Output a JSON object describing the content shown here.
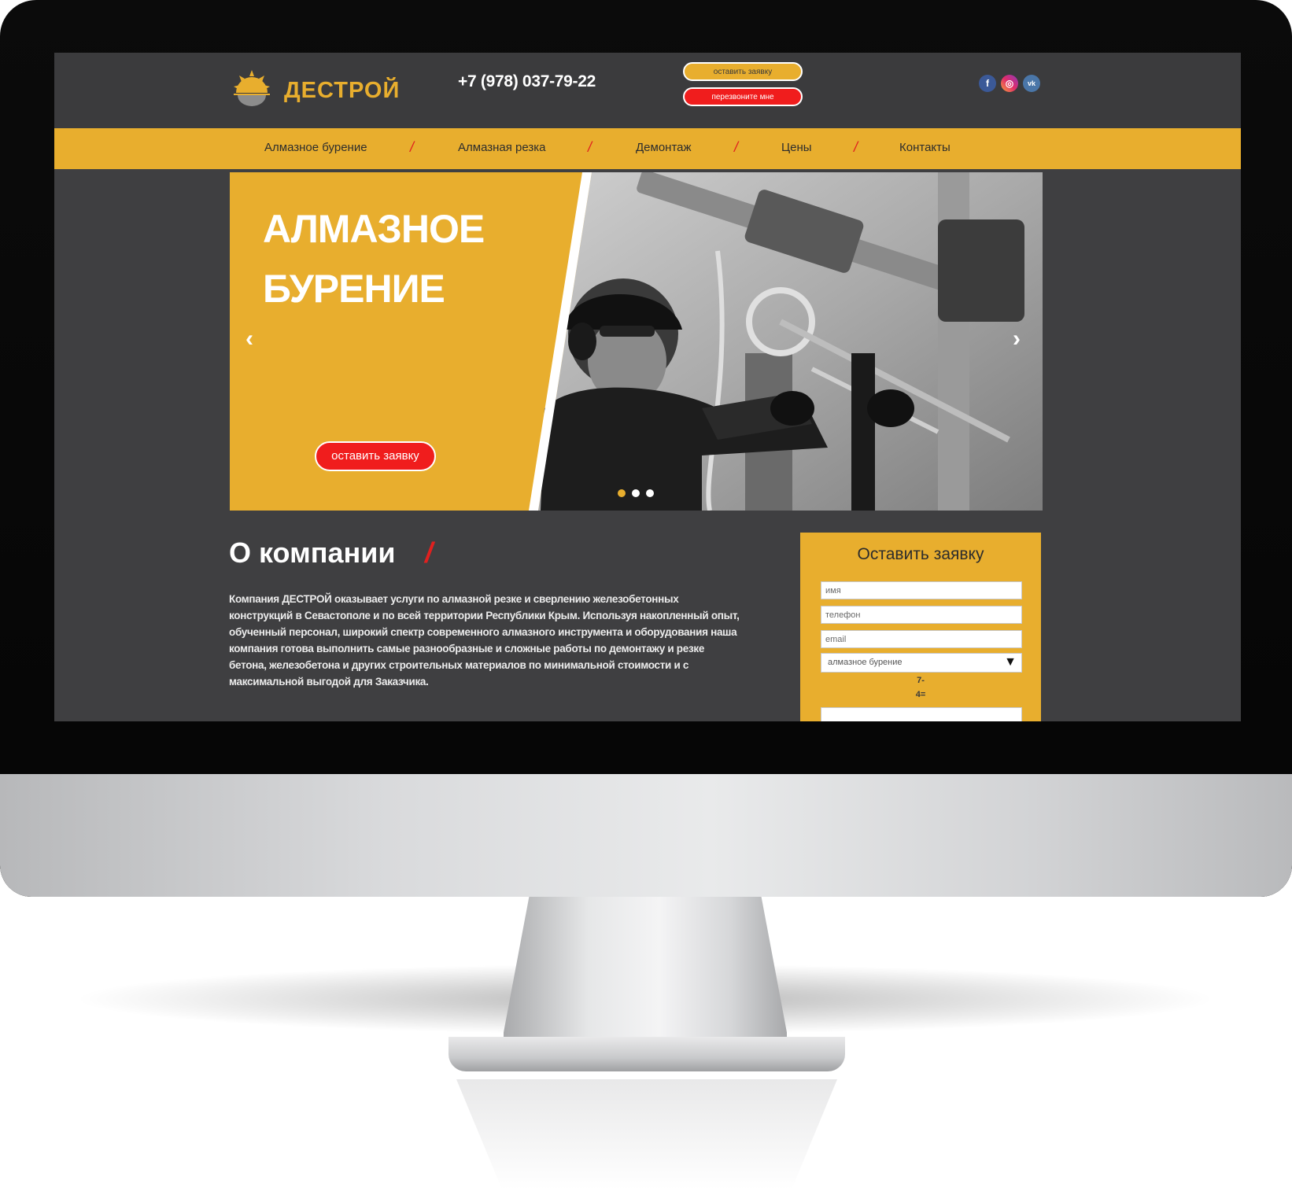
{
  "brand": {
    "name": "ДЕСТРОЙ",
    "accent_color": "#e8ae2e",
    "red_color": "#f01d1d",
    "dark_color": "#3f3f41"
  },
  "header": {
    "phone": "+7 (978) 037-79-22",
    "request_button": "оставить заявку",
    "callback_button": "перезвоните мне",
    "socials": [
      {
        "icon": "facebook-icon",
        "glyph": "f"
      },
      {
        "icon": "instagram-icon",
        "glyph": "◎"
      },
      {
        "icon": "vk-icon",
        "glyph": "vk"
      }
    ]
  },
  "nav": {
    "items": [
      "Алмазное бурение",
      "Алмазная резка",
      "Демонтаж",
      "Цены",
      "Контакты"
    ],
    "separator": "/"
  },
  "slider": {
    "title_line1": "АЛМАЗНОЕ",
    "title_line2": "БУРЕНИЕ",
    "cta": "оставить заявку",
    "prev_icon": "‹",
    "next_icon": "›",
    "slide_count": 3,
    "active_slide": 1
  },
  "about": {
    "title": "О компании",
    "slash": "/",
    "text": "Компания ДЕСТРОЙ оказывает услуги по алмазной резке и сверлению железобетонных конструкций в Севастополе и по  всей территории Республики Крым. Используя накопленный опыт, обученный персонал, широкий спектр современного алмазного инструмента и оборудования наша компания готова выполнить самые разнообразные и сложные работы по демонтажу и резке бетона, железобетона и других строительных материалов по минимальной стоимости и с максимальной выгодой для Заказчика."
  },
  "form": {
    "title": "Оставить заявку",
    "name_placeholder": "имя",
    "phone_placeholder": "телефон",
    "email_placeholder": "email",
    "service_selected": "алмазное бурение",
    "select_arrow": "▼",
    "captcha_line1": "7-",
    "captcha_line2": "4="
  }
}
